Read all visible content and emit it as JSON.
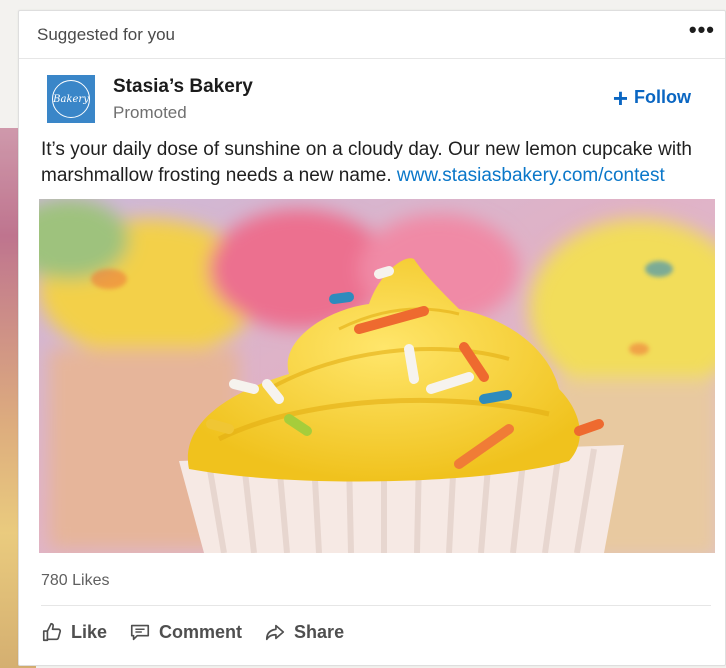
{
  "card": {
    "header_label": "Suggested for you",
    "more_label": "•••"
  },
  "author": {
    "logo_text": "Bakery",
    "name": "Stasia’s Bakery",
    "subtitle": "Promoted",
    "follow_label": "Follow"
  },
  "post": {
    "text": "It’s your daily dose of sunshine on a cloudy day. Our new lemon cupcake with marshmallow frosting needs a new name.",
    "link": "www.stasiasbakery.com/contest",
    "image_icon": "lemon-cupcake-photo"
  },
  "social": {
    "likes_text": "780  Likes"
  },
  "actions": [
    {
      "label": "Like",
      "icon": "thumbs-up-icon"
    },
    {
      "label": "Comment",
      "icon": "comment-icon"
    },
    {
      "label": "Share",
      "icon": "share-arrow-icon"
    }
  ],
  "colors": {
    "accent": "#0a66c2",
    "link": "#0a77c9",
    "logo_bg": "#3a86c8"
  }
}
